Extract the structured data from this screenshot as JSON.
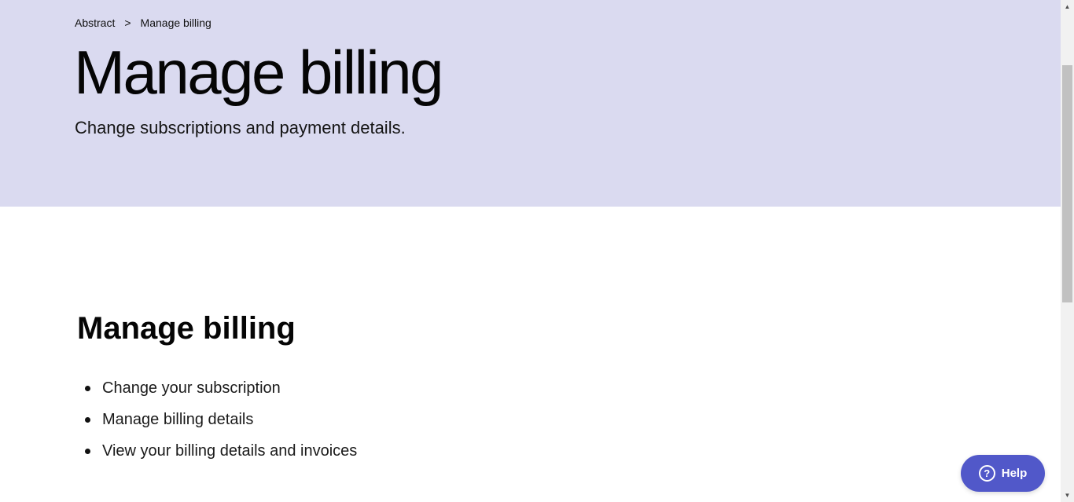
{
  "breadcrumb": {
    "root": "Abstract",
    "separator": ">",
    "current": "Manage billing"
  },
  "hero": {
    "title": "Manage billing",
    "subtitle": "Change subscriptions and payment details.",
    "background": "#dadaf0"
  },
  "section": {
    "title": "Manage billing",
    "links": [
      {
        "label": "Change your subscription"
      },
      {
        "label": "Manage billing details"
      },
      {
        "label": "View your billing details and invoices"
      }
    ]
  },
  "help": {
    "label": "Help",
    "icon": "question-circle-icon",
    "icon_glyph": "?",
    "color": "#5158c9"
  },
  "scrollbar": {
    "up_glyph": "▲",
    "down_glyph": "▼"
  }
}
